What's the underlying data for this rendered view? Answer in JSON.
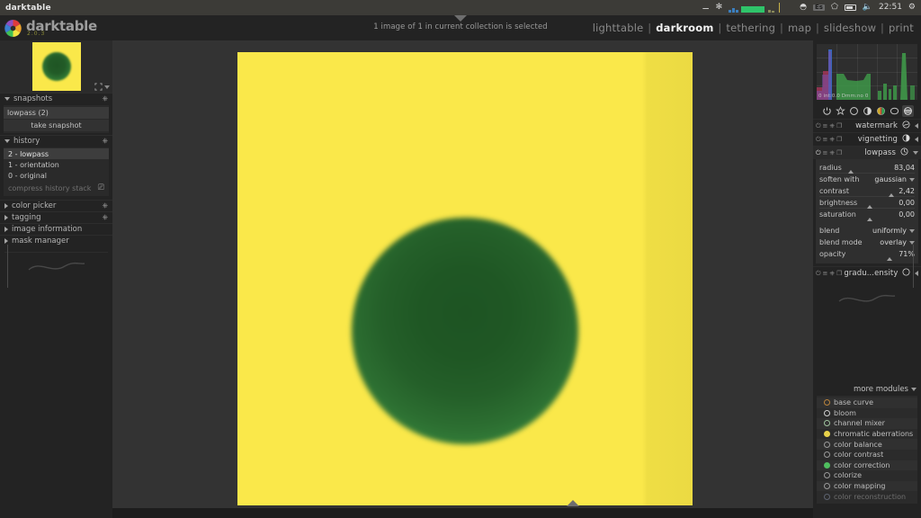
{
  "system_bar": {
    "window_title": "darktable",
    "time": "22:51",
    "icons": [
      "usb-icon",
      "bug-icon",
      "network-graph-icon",
      "wifi-icon",
      "keyboard-layout-icon",
      "bluetooth-icon",
      "battery-icon",
      "volume-muted-icon",
      "settings-icon"
    ],
    "keyboard_layout": "Es"
  },
  "app": {
    "name": "darktable",
    "version": "2.0.3",
    "logo_icon": "darktable-aperture-logo"
  },
  "top_panel": {
    "status_text": "1 image of 1 in current collection is selected",
    "collapse_icon": "chevron-down-icon"
  },
  "views": {
    "separator": "|",
    "items": [
      {
        "label": "lighttable",
        "active": false
      },
      {
        "label": "darkroom",
        "active": true
      },
      {
        "label": "tethering",
        "active": false
      },
      {
        "label": "map",
        "active": false
      },
      {
        "label": "slideshow",
        "active": false
      },
      {
        "label": "print",
        "active": false
      }
    ]
  },
  "navigation": {
    "thumbnail_icon": "image-preview",
    "zoom_fit_icon": "fit-to-screen-icon",
    "dropdown_icon": "chevron-down-icon"
  },
  "left_panel": {
    "snapshots": {
      "title": "snapshots",
      "expanded": true,
      "reset_icon": "reset-icon",
      "items": [
        {
          "label": "lowpass (2)"
        }
      ],
      "take_snapshot_label": "take snapshot"
    },
    "history": {
      "title": "history",
      "expanded": true,
      "reset_icon": "reset-icon",
      "items": [
        {
          "label": "2 - lowpass",
          "selected": true
        },
        {
          "label": "1 - orientation",
          "selected": false
        },
        {
          "label": "0 - original",
          "selected": false
        }
      ],
      "compress_label": "compress history stack",
      "compress_icon": "compress-icon"
    },
    "collapsed_sections": [
      {
        "label": "color picker",
        "reset_icon": "reset-icon",
        "has_reset": true
      },
      {
        "label": "tagging",
        "reset_icon": "reset-icon",
        "has_reset": true
      },
      {
        "label": "image information",
        "has_reset": false
      },
      {
        "label": "mask manager",
        "has_reset": false
      }
    ],
    "collapse_handle_icon": "chevron-left-icon"
  },
  "right_panel": {
    "histogram": {
      "overlay_text": "0 int:0.0  Dmm:no 0",
      "channels": [
        "red",
        "green",
        "blue"
      ]
    },
    "module_tabs": [
      {
        "name": "active-modules-tab",
        "icon": "power-icon",
        "active": false
      },
      {
        "name": "favorite-modules-tab",
        "icon": "star-icon",
        "active": false
      },
      {
        "name": "basic-group-tab",
        "icon": "circle-icon",
        "active": false
      },
      {
        "name": "tone-group-tab",
        "icon": "half-circle-icon",
        "active": false
      },
      {
        "name": "color-group-tab",
        "icon": "color-circle-icon",
        "active": false
      },
      {
        "name": "correction-group-tab",
        "icon": "circle-outline-icon",
        "active": false
      },
      {
        "name": "effect-group-tab",
        "icon": "effects-icon",
        "active": true
      }
    ],
    "modules": [
      {
        "name": "watermark",
        "label": "watermark",
        "expanded": false,
        "shape_icon": "watermark-icon",
        "controls": [
          "power-icon",
          "presets-icon",
          "reset-icon",
          "multi-instance-icon"
        ]
      },
      {
        "name": "vignetting",
        "label": "vignetting",
        "expanded": false,
        "shape_icon": "vignetting-icon",
        "controls": [
          "power-icon",
          "presets-icon",
          "reset-icon",
          "multi-instance-icon"
        ]
      },
      {
        "name": "lowpass",
        "label": "lowpass",
        "expanded": true,
        "shape_icon": "lowpass-icon",
        "controls": [
          "power-icon",
          "presets-icon",
          "reset-icon",
          "multi-instance-icon"
        ],
        "sliders": [
          {
            "label": "radius",
            "value": "83,04",
            "fill": 0.3
          },
          {
            "label": "contrast",
            "value": "2,42",
            "fill": 0.73
          },
          {
            "label": "brightness",
            "value": "0,00",
            "fill": 0.5
          },
          {
            "label": "saturation",
            "value": "0,00",
            "fill": 0.5
          }
        ],
        "combos": [
          {
            "label": "soften with",
            "value": "gaussian"
          }
        ],
        "blend": {
          "blend_label": "blend",
          "blend_value": "uniformly",
          "blend_mode_label": "blend mode",
          "blend_mode_value": "overlay",
          "opacity_label": "opacity",
          "opacity_value": "71%",
          "opacity_fill": 0.71
        }
      },
      {
        "name": "graduated-density",
        "label": "gradu...ensity",
        "expanded": false,
        "shape_icon": "graduated-density-icon",
        "controls": [
          "power-icon",
          "presets-icon",
          "reset-icon",
          "multi-instance-icon"
        ]
      }
    ],
    "more_modules": {
      "label": "more modules",
      "dropdown_icon": "chevron-down-icon"
    },
    "module_list": [
      {
        "label": "base curve",
        "icon": "base-curve-icon",
        "accent": "#b9833c"
      },
      {
        "label": "bloom",
        "icon": "bloom-icon",
        "accent": "#cfcfcf"
      },
      {
        "label": "channel mixer",
        "icon": "channel-mixer-icon",
        "accent": "#9fc49f"
      },
      {
        "label": "chromatic aberrations",
        "icon": "chromatic-aberrations-icon",
        "accent": "#e8d24a"
      },
      {
        "label": "color balance",
        "icon": "color-balance-icon",
        "accent": "#bdbdbd"
      },
      {
        "label": "color contrast",
        "icon": "color-contrast-icon",
        "accent": "#bdbdbd"
      },
      {
        "label": "color correction",
        "icon": "color-correction-icon",
        "accent": "#4fbf5f"
      },
      {
        "label": "colorize",
        "icon": "colorize-icon",
        "accent": "#bdbdbd"
      },
      {
        "label": "color mapping",
        "icon": "color-mapping-icon",
        "accent": "#bdbdbd"
      },
      {
        "label": "color reconstruction",
        "icon": "color-reconstruction-icon",
        "accent": "#9aa7c4"
      }
    ],
    "collapse_handle_icon": "chevron-right-icon"
  },
  "center": {
    "image": {
      "background_color": "#fae84a",
      "circle_color_center": "#1e5423",
      "circle_color_edge": "#43994a",
      "gradient_overlay": "graduated-density-right"
    },
    "collapse_bottom_icon": "chevron-up-icon"
  },
  "colors": {
    "panel_bg": "#232323",
    "center_bg": "#333333",
    "accent_yellow": "#fae84a",
    "accent_green": "#215a26",
    "text": "#b0b0b0",
    "text_bright": "#f2f2f2"
  }
}
